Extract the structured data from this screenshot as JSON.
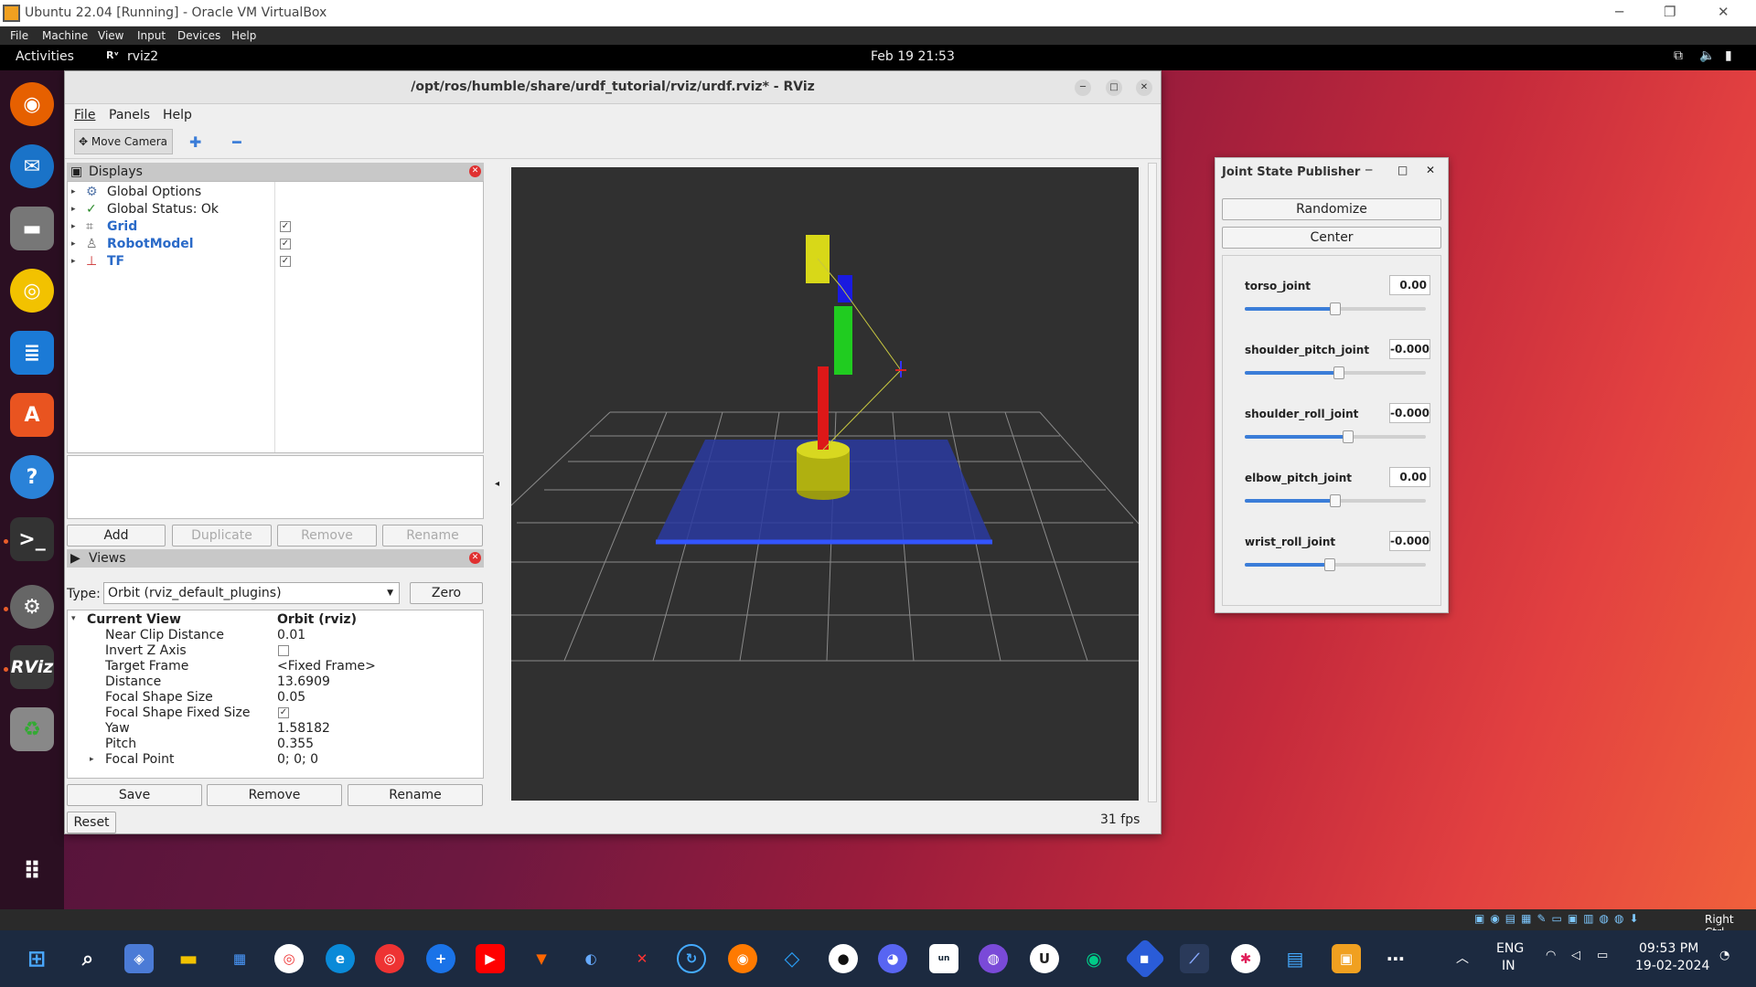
{
  "vbox": {
    "title": "Ubuntu 22.04 [Running] - Oracle VM VirtualBox",
    "menu": [
      "File",
      "Machine",
      "View",
      "Input",
      "Devices",
      "Help"
    ],
    "status_right": "Right Ctrl"
  },
  "gnome": {
    "activities": "Activities",
    "app_name": "rviz2",
    "clock": "Feb 19  21:53"
  },
  "rviz": {
    "title": "/opt/ros/humble/share/urdf_tutorial/rviz/urdf.rviz* - RViz",
    "menu": [
      "File",
      "Panels",
      "Help"
    ],
    "toolbar": {
      "move_camera": "Move Camera"
    },
    "displays": {
      "title": "Displays",
      "items": [
        {
          "label": "Global Options",
          "checked": null
        },
        {
          "label": "Global Status: Ok",
          "checked": null
        },
        {
          "label": "Grid",
          "checked": true
        },
        {
          "label": "RobotModel",
          "checked": true
        },
        {
          "label": "TF",
          "checked": true
        }
      ],
      "buttons": [
        "Add",
        "Duplicate",
        "Remove",
        "Rename"
      ]
    },
    "views": {
      "title": "Views",
      "type_label": "Type:",
      "type_value": "Orbit (rviz_default_plugins)",
      "zero": "Zero",
      "current_view": "Current View",
      "current_view_value": "Orbit (rviz)",
      "props": [
        {
          "name": "Near Clip Distance",
          "value": "0.01"
        },
        {
          "name": "Invert Z Axis",
          "value": ""
        },
        {
          "name": "Target Frame",
          "value": "<Fixed Frame>"
        },
        {
          "name": "Distance",
          "value": "13.6909"
        },
        {
          "name": "Focal Shape Size",
          "value": "0.05"
        },
        {
          "name": "Focal Shape Fixed Size",
          "value": ""
        },
        {
          "name": "Yaw",
          "value": "1.58182"
        },
        {
          "name": "Pitch",
          "value": "0.355"
        },
        {
          "name": "Focal Point",
          "value": "0; 0; 0"
        }
      ],
      "buttons": [
        "Save",
        "Remove",
        "Rename"
      ]
    },
    "reset": "Reset",
    "fps": "31 fps"
  },
  "jsp": {
    "title": "Joint State Publisher",
    "randomize": "Randomize",
    "center": "Center",
    "joints": [
      {
        "name": "torso_joint",
        "value": "0.00",
        "fraction": 0.5
      },
      {
        "name": "shoulder_pitch_joint",
        "value": "-0.000",
        "fraction": 0.52
      },
      {
        "name": "shoulder_roll_joint",
        "value": "-0.000",
        "fraction": 0.57
      },
      {
        "name": "elbow_pitch_joint",
        "value": "0.00",
        "fraction": 0.5
      },
      {
        "name": "wrist_roll_joint",
        "value": "-0.000",
        "fraction": 0.47
      }
    ]
  },
  "taskbar": {
    "lang1": "ENG",
    "lang2": "IN",
    "time": "09:53 PM",
    "date": "19-02-2024"
  }
}
